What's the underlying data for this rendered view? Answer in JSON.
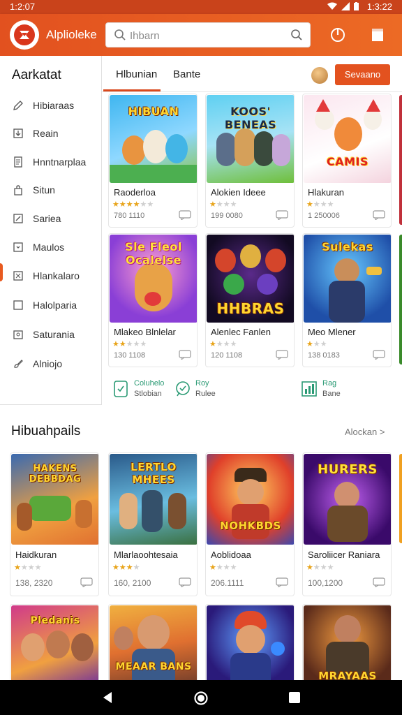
{
  "status_bar": {
    "time_left": "1:2:07",
    "time_right": "1:3:22"
  },
  "app_bar": {
    "app_name": "Alplioleke",
    "search_placeholder": "Ihbarn",
    "accent": "#e2511f"
  },
  "sidebar": {
    "title": "Aarkatat",
    "items": [
      {
        "label": "Hibiaraas",
        "icon": "pencil-icon"
      },
      {
        "label": "Reain",
        "icon": "download-icon"
      },
      {
        "label": "Hnntnarplaa",
        "icon": "document-icon"
      },
      {
        "label": "Situn",
        "icon": "bag-icon"
      },
      {
        "label": "Sariea",
        "icon": "edit-box-icon"
      },
      {
        "label": "Maulos",
        "icon": "download-box-icon"
      },
      {
        "label": "Hlankalaro",
        "icon": "grid-icon"
      },
      {
        "label": "Halolparia",
        "icon": "square-icon"
      },
      {
        "label": "Saturania",
        "icon": "lock-box-icon"
      },
      {
        "label": "Alniojo",
        "icon": "brush-icon"
      }
    ]
  },
  "tabs": [
    {
      "label": "Hlbunian",
      "active": true
    },
    {
      "label": "Bante",
      "active": false
    }
  ],
  "cta_label": "Sevaano",
  "featured_cards": [
    {
      "title": "Raoderloa",
      "thumb_text": "HIBUAN",
      "rating": 4,
      "meta": "780 1110"
    },
    {
      "title": "Alokien Ideee",
      "thumb_text": "KOOS' BENEAS",
      "rating": 1,
      "meta": "199 0080"
    },
    {
      "title": "Hlakuran",
      "thumb_text": "CAMIS",
      "rating": 1,
      "meta": "1 250006"
    },
    {
      "title": "Mlakeo Blnlelar",
      "thumb_text": "Sle Fleol Ocalelse",
      "rating": 2,
      "meta": "130 1108"
    },
    {
      "title": "Alenlec Fanlen",
      "thumb_text": "HHBRAS",
      "rating": 1,
      "meta": "120 1108"
    },
    {
      "title": "Meo Mlener",
      "thumb_text": "Sulekas",
      "rating": 1,
      "meta": "138 0183"
    }
  ],
  "features": [
    {
      "line1": "Coluhelo",
      "line2": "Stlobian",
      "icon": "tablet-icon"
    },
    {
      "line1": "Roy",
      "line2": "Rulee",
      "icon": "chat-icon"
    },
    {
      "line1": "Rag",
      "line2": "Bane",
      "icon": "chart-icon"
    }
  ],
  "section": {
    "title": "Hibuahpails",
    "see_all": "Alockan >"
  },
  "section_cards": [
    {
      "title": "Haidkuran",
      "thumb_text": "HAKENS DEBBDAG",
      "rating": 1,
      "meta": "138, 2320"
    },
    {
      "title": "Mlarlaoohtesaia",
      "thumb_text": "LERTLO MHEES",
      "rating": 3,
      "meta": "160, 2100"
    },
    {
      "title": "Aoblidoaa",
      "thumb_text": "NOHKBDS",
      "rating": 1,
      "meta": "206.1111"
    },
    {
      "title": "Saroliicer Raniara",
      "thumb_text": "HURERS",
      "rating": 1,
      "meta": "100,1200"
    },
    {
      "title": "",
      "thumb_text": "Pledanis",
      "rating": 0,
      "meta": ""
    },
    {
      "title": "",
      "thumb_text": "MEAAR BANS",
      "rating": 0,
      "meta": ""
    },
    {
      "title": "",
      "thumb_text": "",
      "rating": 0,
      "meta": ""
    },
    {
      "title": "",
      "thumb_text": "MRAYAAS",
      "rating": 0,
      "meta": ""
    }
  ]
}
